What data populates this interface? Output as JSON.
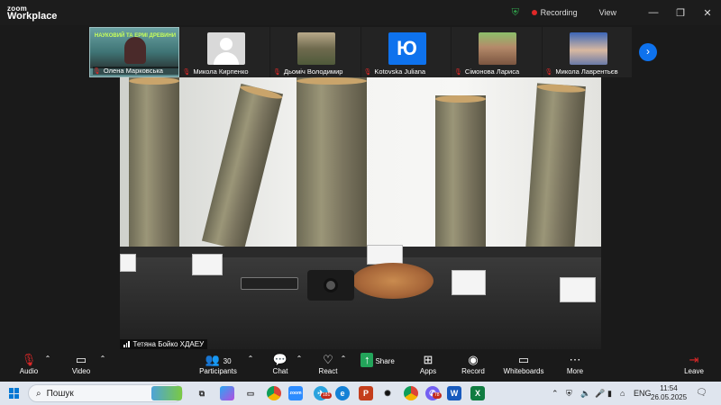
{
  "app": {
    "logo_line1": "zoom",
    "logo_line2": "Workplace",
    "recording_label": "Recording",
    "view_label": "View",
    "window_controls": [
      "minimize-icon",
      "restore-icon",
      "close-icon"
    ]
  },
  "participants": [
    {
      "name": "Олена Марковська",
      "muted": true,
      "poster_text": "НАУКОВИЙ ТА ЕРМІ ДРЕВИНИ"
    },
    {
      "name": "Микола Кирпенко",
      "muted": true,
      "avatar": "default"
    },
    {
      "name": "Дьоміч Володимир",
      "muted": true,
      "avatar": "photo"
    },
    {
      "name": "Kotovska Juliana",
      "muted": true,
      "avatar_letter": "Ю"
    },
    {
      "name": "Сімонова Лариса",
      "muted": true,
      "avatar": "photo"
    },
    {
      "name": "Микола Лаврентьєв",
      "muted": true,
      "avatar": "photo"
    }
  ],
  "active_speaker": {
    "name": "Тетяна Бойко ХДАЕУ"
  },
  "toolbar": {
    "audio": "Audio",
    "video": "Video",
    "participants": "Participants",
    "participants_count": "30",
    "chat": "Chat",
    "react": "React",
    "share": "Share",
    "apps": "Apps",
    "record": "Record",
    "whiteboards": "Whiteboards",
    "more": "More",
    "leave": "Leave"
  },
  "taskbar": {
    "search_placeholder": "Пошук",
    "language": "ENG",
    "time": "11:54",
    "date": "26.05.2025",
    "telegram_badge": "181",
    "viber_badge": "78",
    "colors": {
      "accent": "#0e72ed",
      "recording": "#e02828",
      "share": "#23a45a"
    }
  }
}
